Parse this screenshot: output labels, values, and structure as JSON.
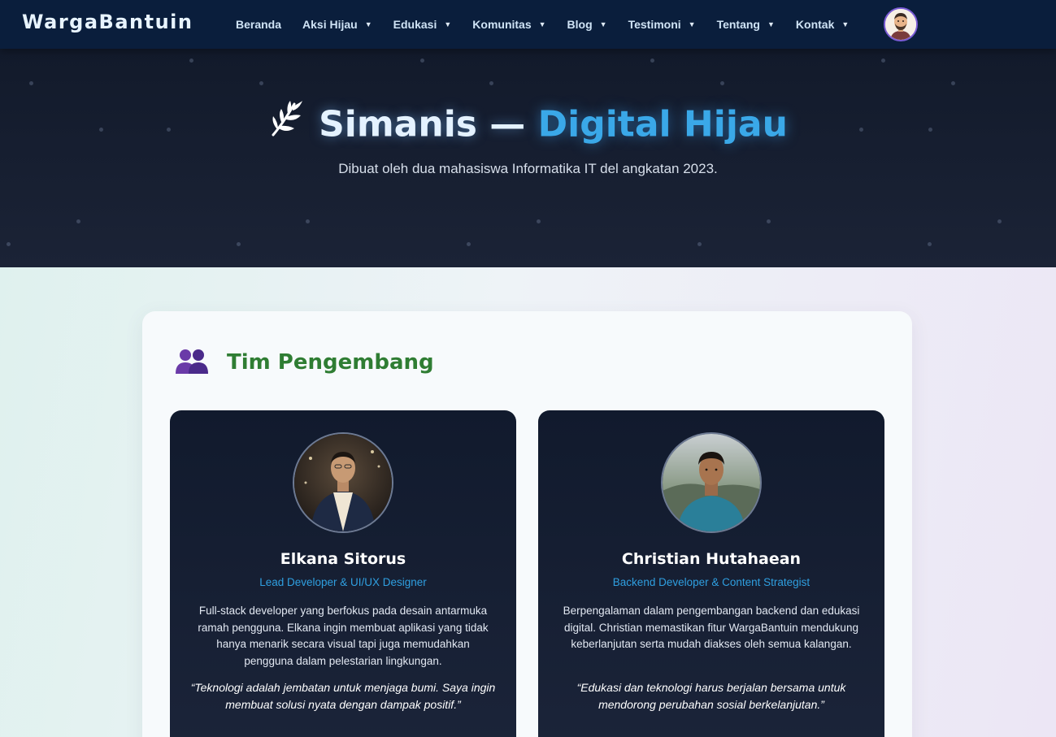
{
  "navbar": {
    "brand": "WargaBantuin",
    "items": [
      {
        "label": "Beranda",
        "dropdown": false
      },
      {
        "label": "Aksi Hijau",
        "dropdown": true
      },
      {
        "label": "Edukasi",
        "dropdown": true
      },
      {
        "label": "Komunitas",
        "dropdown": true
      },
      {
        "label": "Blog",
        "dropdown": true
      },
      {
        "label": "Testimoni",
        "dropdown": true
      },
      {
        "label": "Tentang",
        "dropdown": true
      },
      {
        "label": "Kontak",
        "dropdown": true
      }
    ],
    "caret": "▼",
    "avatar_icon": "user-avatar-icon"
  },
  "hero": {
    "title_part1": "Simanis —",
    "title_part2": "Digital Hijau",
    "icon": "leaf-branch-icon",
    "subtitle": "Dibuat oleh dua mahasiswa Informatika IT del angkatan 2023."
  },
  "team": {
    "icon": "two-people-icon",
    "title": "Tim Pengembang",
    "members": [
      {
        "name": "Elkana Sitorus",
        "role": "Lead Developer & UI/UX Designer",
        "description": "Full-stack developer yang berfokus pada desain antarmuka ramah pengguna. Elkana ingin membuat aplikasi yang tidak hanya menarik secara visual tapi juga memudahkan pengguna dalam pelestarian lingkungan.",
        "quote": "“Teknologi adalah jembatan untuk menjaga bumi. Saya ingin membuat solusi nyata dengan dampak positif.”"
      },
      {
        "name": "Christian Hutahaean",
        "role": "Backend Developer & Content Strategist",
        "description": "Berpengalaman dalam pengembangan backend dan edukasi digital. Christian memastikan fitur WargaBantuin mendukung keberlanjutan serta mudah diakses oleh semua kalangan.",
        "quote": "“Edukasi dan teknologi harus berjalan bersama untuk mendorong perubahan sosial berkelanjutan.”"
      }
    ]
  },
  "colors": {
    "navbar_bg": "#0a1e3c",
    "hero_bg": "#121a2b",
    "accent_blue": "#3aa8e8",
    "section_green": "#2f7d33",
    "card_dark": "#111a2d"
  }
}
